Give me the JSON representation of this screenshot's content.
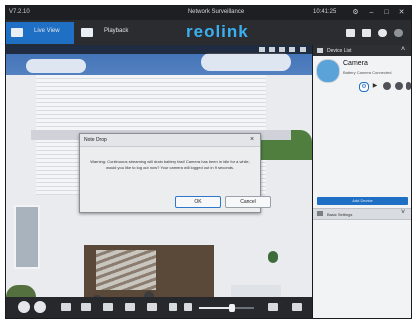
{
  "window": {
    "version": "V7.2.10",
    "title": "Network Surveillance",
    "time": "10:41:25",
    "controls": [
      "gear-icon",
      "minimize-icon",
      "maximize-icon",
      "close-icon"
    ]
  },
  "tabs": [
    {
      "label": "Live View",
      "active": true,
      "icon": "camera-icon"
    },
    {
      "label": "Playback",
      "active": false,
      "icon": "playback-icon"
    }
  ],
  "brand": {
    "logo_text": "reolink",
    "color": "#3bb0f0"
  },
  "accent": "#1f6fc4",
  "dialog": {
    "title": "Note Drop",
    "message": "Warning: Continuous streaming will drain battery fast! Camera has been in idle for a while, would you like to log out now? Your camera will logged out in 9 seconds.",
    "ok_label": "OK",
    "cancel_label": "Cancel"
  },
  "right_panel": {
    "header": "Device List",
    "camera": {
      "name": "Camera",
      "status": "Battery Camera Connected"
    },
    "action_icons": [
      "gear-icon",
      "play-icon",
      "search-icon",
      "refresh-icon",
      "info-icon"
    ],
    "blue_button": "Add Device",
    "footer": "Basic Settings"
  },
  "controls": {
    "left_buttons": [
      "play-icon",
      "stop-icon"
    ],
    "icons": [
      "snapshot-icon",
      "record-icon",
      "talk-icon",
      "quality-icon",
      "ptz-icon",
      "hd-icon",
      "mic-icon",
      "volume-icon",
      "fullscreen-icon",
      "layout-icon"
    ],
    "volume_percent": 60
  }
}
